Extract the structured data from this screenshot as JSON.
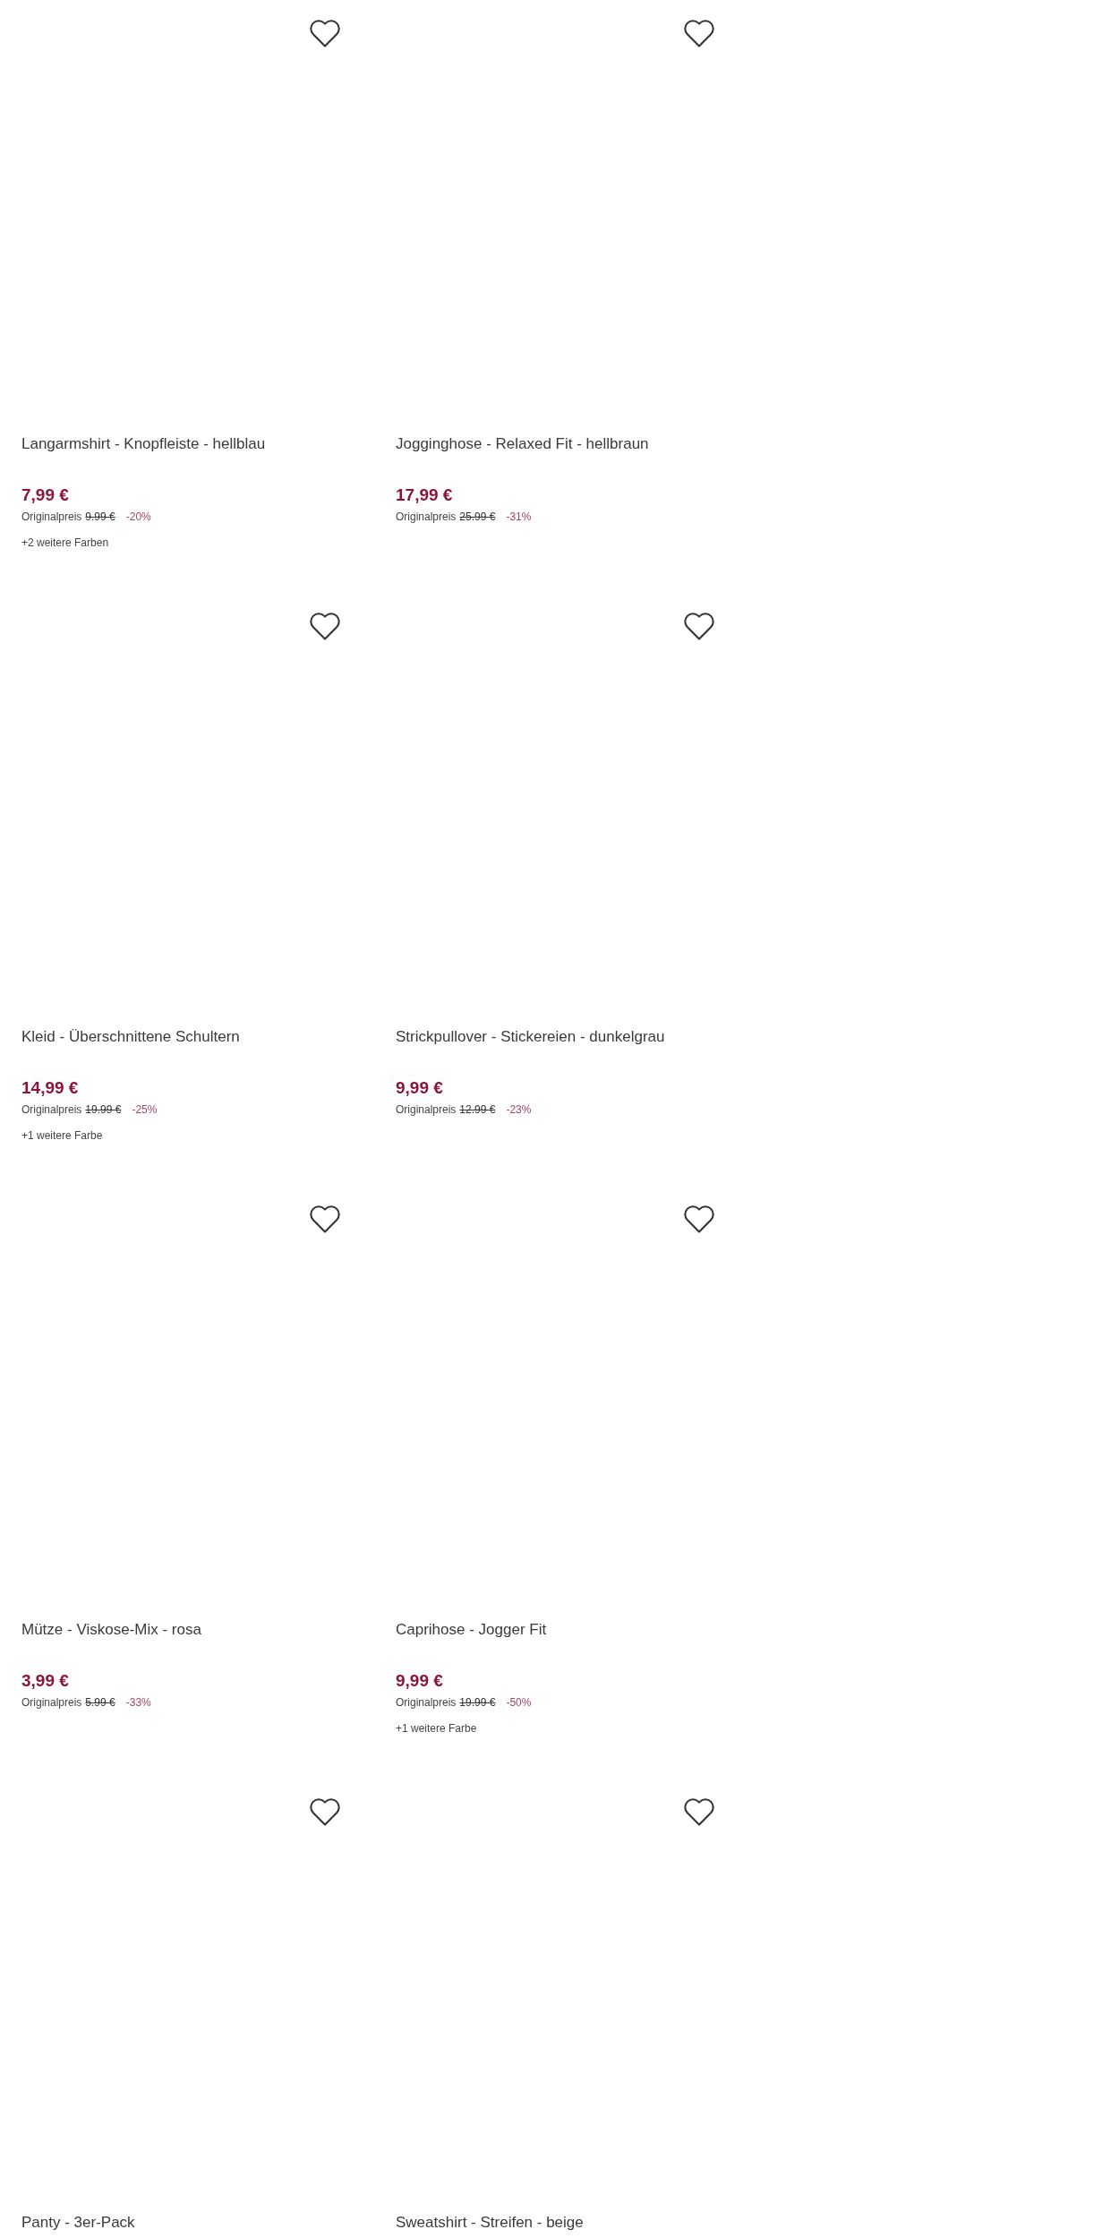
{
  "products": [
    {
      "title": "Langarmshirt - Knopfleiste - hellblau",
      "price": "7,99 €",
      "original_label": "Originalpreis",
      "original_price": "9.99 €",
      "discount": "-20%",
      "more_colors": "+2 weitere Farben"
    },
    {
      "title": "Jogginghose - Relaxed Fit - hellbraun",
      "price": "17,99 €",
      "original_label": "Originalpreis",
      "original_price": "25.99 €",
      "discount": "-31%"
    },
    {
      "title": "Kleid - Überschnittene Schultern",
      "price": "14,99 €",
      "original_label": "Originalpreis",
      "original_price": "19.99 €",
      "discount": "-25%",
      "more_colors": "+1 weitere Farbe"
    },
    {
      "title": "Strickpullover - Stickereien - dunkelgrau",
      "price": "9,99 €",
      "original_label": "Originalpreis",
      "original_price": "12.99 €",
      "discount": "-23%"
    },
    {
      "title": "Mütze - Viskose-Mix - rosa",
      "price": "3,99 €",
      "original_label": "Originalpreis",
      "original_price": "5.99 €",
      "discount": "-33%"
    },
    {
      "title": "Caprihose - Jogger Fit",
      "price": "9,99 €",
      "original_label": "Originalpreis",
      "original_price": "19.99 €",
      "discount": "-50%",
      "more_colors": "+1 weitere Farbe"
    },
    {
      "title": "Panty - 3er-Pack"
    },
    {
      "title": "Sweatshirt - Streifen - beige"
    }
  ]
}
